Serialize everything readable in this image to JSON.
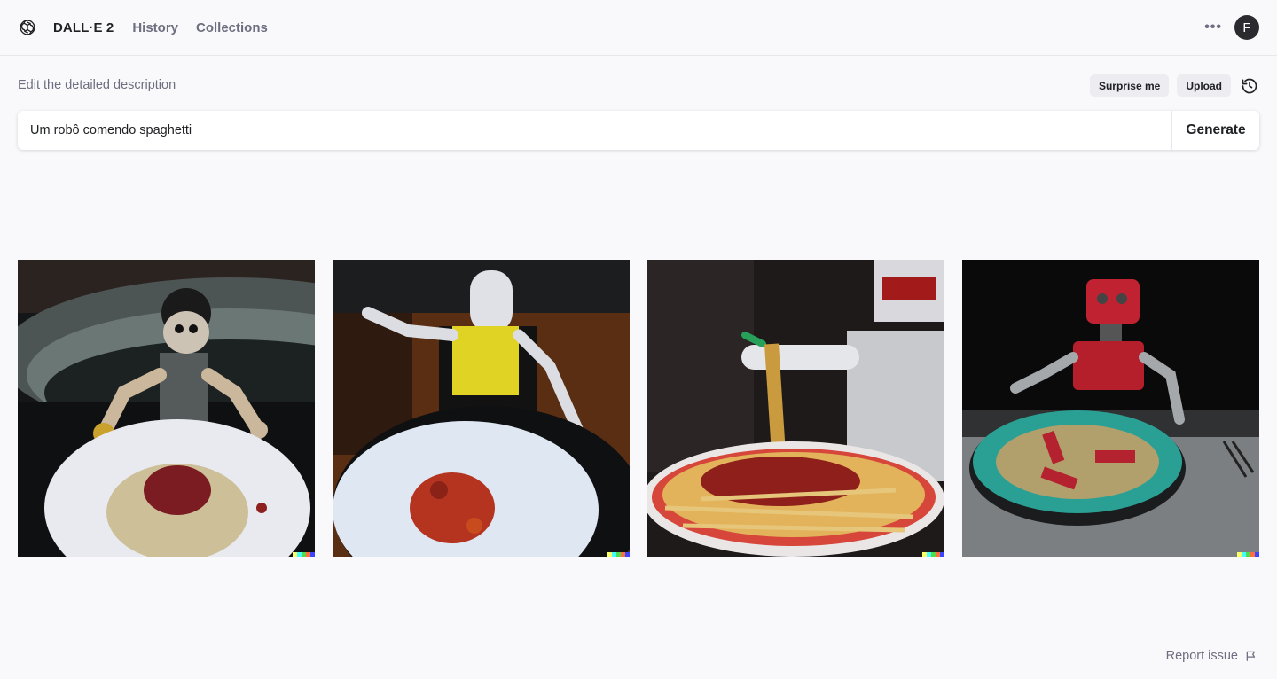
{
  "header": {
    "logo_icon": "openai-logo-icon",
    "brand": "DALL·E 2",
    "nav": [
      {
        "label": "History"
      },
      {
        "label": "Collections"
      }
    ],
    "more_icon": "more-horizontal-icon",
    "avatar_letter": "F"
  },
  "prompt": {
    "label": "Edit the detailed description",
    "surprise_label": "Surprise me",
    "upload_label": "Upload",
    "history_icon": "history-icon",
    "value": "Um robô comendo spaghetti",
    "generate_label": "Generate"
  },
  "results": {
    "images": [
      {
        "alt": "Wooden mannequin robot at table with spaghetti plate"
      },
      {
        "alt": "White robot with yellow bib over plate of sauce"
      },
      {
        "alt": "White robot lifting spaghetti with fork"
      },
      {
        "alt": "Red toy robot with teal plate of spaghetti"
      }
    ],
    "signature_colors": [
      "#ffff66",
      "#42ffff",
      "#51da4c",
      "#ff6e3c",
      "#3c46ff"
    ]
  },
  "footer": {
    "report_label": "Report issue",
    "flag_icon": "flag-icon"
  }
}
